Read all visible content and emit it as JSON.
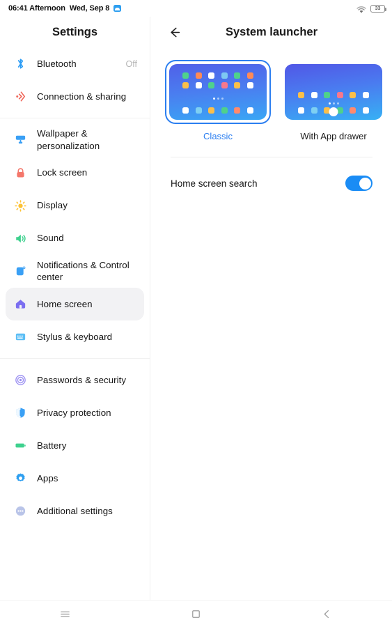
{
  "statusbar": {
    "time": "06:41 Afternoon",
    "date": "Wed, Sep 8",
    "app_icon": "gallery-icon",
    "wifi_icon": "wifi-icon",
    "battery_level": "33"
  },
  "sidebar": {
    "title": "Settings",
    "groups": [
      {
        "items": [
          {
            "label": "Bluetooth",
            "value": "Off",
            "icon": "bluetooth-icon",
            "selected": false
          },
          {
            "label": "Connection & sharing",
            "value": "",
            "icon": "connection-sharing-icon",
            "selected": false
          }
        ]
      },
      {
        "items": [
          {
            "label": "Wallpaper & personalization",
            "value": "",
            "icon": "wallpaper-icon",
            "selected": false
          },
          {
            "label": "Lock screen",
            "value": "",
            "icon": "lock-icon",
            "selected": false
          },
          {
            "label": "Display",
            "value": "",
            "icon": "display-brightness-icon",
            "selected": false
          },
          {
            "label": "Sound",
            "value": "",
            "icon": "sound-speaker-icon",
            "selected": false
          },
          {
            "label": "Notifications & Control center",
            "value": "",
            "icon": "notifications-icon",
            "selected": false
          },
          {
            "label": "Home screen",
            "value": "",
            "icon": "home-icon",
            "selected": true
          },
          {
            "label": "Stylus & keyboard",
            "value": "",
            "icon": "keyboard-icon",
            "selected": false
          }
        ]
      },
      {
        "items": [
          {
            "label": "Passwords & security",
            "value": "",
            "icon": "fingerprint-security-icon",
            "selected": false
          },
          {
            "label": "Privacy protection",
            "value": "",
            "icon": "privacy-shield-icon",
            "selected": false
          },
          {
            "label": "Battery",
            "value": "",
            "icon": "battery-icon",
            "selected": false
          },
          {
            "label": "Apps",
            "value": "",
            "icon": "apps-gear-icon",
            "selected": false
          },
          {
            "label": "Additional settings",
            "value": "",
            "icon": "more-dots-icon",
            "selected": false
          }
        ]
      }
    ]
  },
  "content": {
    "back_icon": "back-arrow-icon",
    "title": "System launcher",
    "launcher_options": [
      {
        "label": "Classic",
        "selected": true,
        "preview_rows": [
          [
            "#4fd18b",
            "#ff8a56",
            "#ffffff",
            "#7ec8f2",
            "#4fd18b",
            "#ff8a56"
          ],
          [
            "#fbbf4a",
            "#ffffff",
            "#4fd18b",
            "#f8788c",
            "#fbbf4a",
            "#ffffff"
          ]
        ],
        "dock_row": [
          "#ffffff",
          "#7ed0f2",
          "#fbbf4a",
          "#4fd18b",
          "#ff8a6e",
          "#ffffff"
        ],
        "has_drawer_button": false
      },
      {
        "label": "With App drawer",
        "selected": false,
        "preview_rows": [
          [
            "#fbbf4a",
            "#ffffff",
            "#4fd18b",
            "#f8788c",
            "#fbbf4a",
            "#ffffff"
          ],
          [
            "#ffffff",
            "#7ed0f2",
            "#fbbf4a",
            "#4fd18b",
            "#ff8a6e",
            "#ffffff"
          ]
        ],
        "dock_row": [],
        "has_drawer_button": true
      }
    ],
    "settings": [
      {
        "label": "Home screen search",
        "toggle_on": true,
        "toggle_color": "#1a8cf5"
      }
    ]
  },
  "navbar": {
    "buttons": [
      {
        "name": "recents-menu-icon"
      },
      {
        "name": "home-square-icon"
      },
      {
        "name": "back-chevron-icon"
      }
    ]
  },
  "colors": {
    "accent": "#2b7ef0",
    "selected_row_bg": "#f2f2f4",
    "text_primary": "#141414",
    "text_muted": "#b5b5b5"
  }
}
